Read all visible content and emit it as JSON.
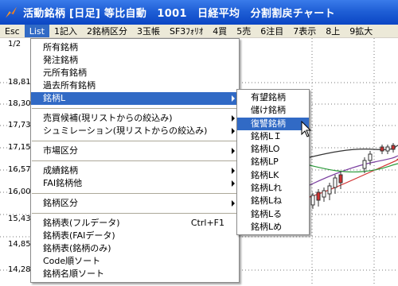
{
  "window": {
    "title": "活動銘柄 [日足] 等比自動　1001　日経平均　分割割戻チャート"
  },
  "menubar": {
    "items": [
      "Esc",
      "List",
      "1記入",
      "2銘柄区分",
      "3玉帳",
      "SF3ﾌｫﾘｵ",
      "4買",
      "5売",
      "6注目",
      "7表示",
      "8上",
      "9拡大"
    ],
    "active": "List"
  },
  "chart": {
    "yticks": [
      "1/2",
      "18,81",
      "18,30",
      "17,73",
      "17,15",
      "16,57",
      "16,00",
      "15,43",
      "14,85",
      "14,28"
    ]
  },
  "list_menu": {
    "items": [
      {
        "label": "所有銘柄"
      },
      {
        "label": "発注銘柄"
      },
      {
        "label": "元所有銘柄"
      },
      {
        "label": "過去所有銘柄"
      },
      {
        "label": "銘柄L"
      },
      {
        "label": "売買候補(現リストからの絞込み)"
      },
      {
        "label": "シュミレーション(現リストからの絞込み)"
      },
      {
        "label": "市場区分"
      },
      {
        "label": "成績銘柄"
      },
      {
        "label": "FAI銘柄他"
      },
      {
        "label": "銘柄区分"
      },
      {
        "label": "銘柄表(フルデータ)",
        "shortcut": "Ctrl+F1"
      },
      {
        "label": "銘柄表(FAIデータ)"
      },
      {
        "label": "銘柄表(銘柄のみ)"
      },
      {
        "label": "Code順ソート"
      },
      {
        "label": "銘柄名順ソート"
      }
    ]
  },
  "submenu": {
    "items": [
      "有望銘柄",
      "儲け銘柄",
      "復讐銘柄",
      "銘柄LＩ",
      "銘柄LO",
      "銘柄LP",
      "銘柄LK",
      "銘柄Lれ",
      "銘柄Lね",
      "銘柄Lる",
      "銘柄Lめ"
    ],
    "highlighted": "復讐銘柄"
  },
  "colors": {
    "highlight": "#316ac5",
    "titlebar": "#1f5fd6",
    "menubar": "#ece9d8"
  }
}
